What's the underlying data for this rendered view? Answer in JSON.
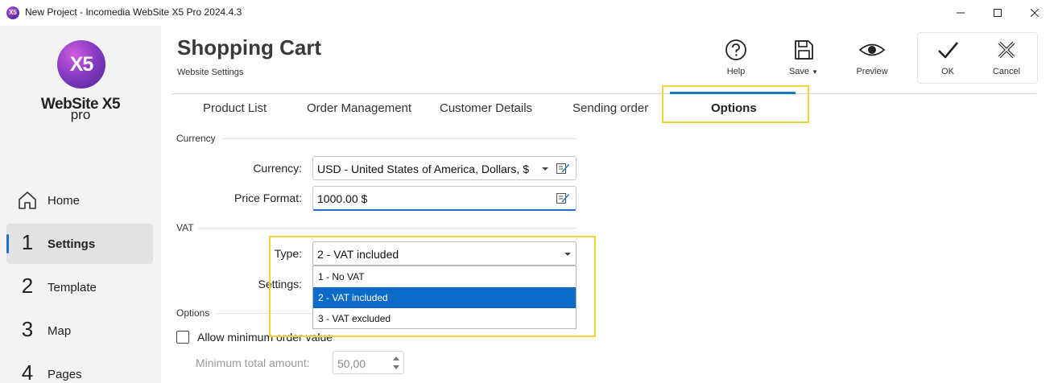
{
  "window": {
    "title": "New Project - Incomedia WebSite X5 Pro 2024.4.3",
    "icon_text": "X5"
  },
  "logo": {
    "mark": "X5",
    "name": "WebSite X5",
    "edition": "pro"
  },
  "sidebar": {
    "items": [
      {
        "marker": "home-icon",
        "label": "Home",
        "active": false
      },
      {
        "marker": "1",
        "label": "Settings",
        "active": true
      },
      {
        "marker": "2",
        "label": "Template",
        "active": false
      },
      {
        "marker": "3",
        "label": "Map",
        "active": false
      },
      {
        "marker": "4",
        "label": "Pages",
        "active": false
      }
    ]
  },
  "header": {
    "title": "Shopping Cart",
    "subtitle": "Website Settings"
  },
  "toolbar": {
    "help": {
      "icon": "help-icon",
      "label": "Help"
    },
    "save": {
      "icon": "save-icon",
      "label": "Save"
    },
    "preview": {
      "icon": "preview-eye-icon",
      "label": "Preview"
    },
    "ok": {
      "icon": "checkmark-icon",
      "label": "OK"
    },
    "cancel": {
      "icon": "cancel-x-icon",
      "label": "Cancel"
    }
  },
  "tabs": [
    {
      "label": "Product List",
      "active": false
    },
    {
      "label": "Order Management",
      "active": false
    },
    {
      "label": "Customer Details",
      "active": false
    },
    {
      "label": "Sending order",
      "active": false
    },
    {
      "label": "Options",
      "active": true
    }
  ],
  "currency_section": {
    "title": "Currency",
    "currency_label": "Currency:",
    "currency_value": "USD - United States of America, Dollars, $",
    "price_format_label": "Price Format:",
    "price_format_value": "1000.00 $"
  },
  "vat_section": {
    "title": "VAT",
    "type_label": "Type:",
    "type_value": "2 - VAT included",
    "settings_label": "Settings:",
    "options": [
      {
        "label": "1 - No VAT",
        "selected": false
      },
      {
        "label": "2 - VAT included",
        "selected": true
      },
      {
        "label": "3 - VAT excluded",
        "selected": false
      }
    ]
  },
  "options_section": {
    "title": "Options",
    "min_order_checkbox_label": "Allow minimum order value",
    "min_order_checked": false,
    "min_total_label": "Minimum total amount:",
    "min_total_value": "50,00"
  },
  "colors": {
    "accent": "#1f6fd1",
    "selection": "#0c6bc9",
    "highlight": "#f2d33a",
    "tab_underline": "#1f7bbf"
  }
}
